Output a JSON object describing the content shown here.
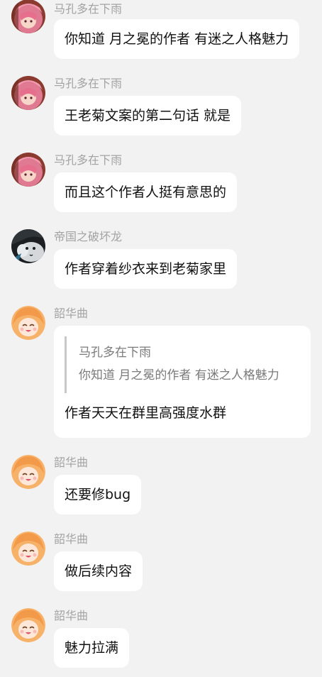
{
  "messages": [
    {
      "sender": "马孔多在下雨",
      "text": "你知道 月之冕的作者 有迷之人格魅力"
    },
    {
      "sender": "马孔多在下雨",
      "text": "王老菊文案的第二句话 就是"
    },
    {
      "sender": "马孔多在下雨",
      "text": "而且这个作者人挺有意思的"
    },
    {
      "sender": "帝国之破坏龙",
      "text": "作者穿着纱衣来到老菊家里"
    },
    {
      "sender": "韶华曲",
      "quote": {
        "author": "马孔多在下雨",
        "text": "你知道 月之冕的作者 有迷之人格魅力"
      },
      "text": "作者天天在群里高强度水群"
    },
    {
      "sender": "韶华曲",
      "text": "还要修bug"
    },
    {
      "sender": "韶华曲",
      "text": "做后续内容"
    },
    {
      "sender": "韶华曲",
      "text": "魅力拉满"
    }
  ],
  "avatars": {
    "makongduo": "pink-hair-anime-avatar",
    "dragon": "dark-dragon-avatar",
    "shaohuaqu": "orange-hair-anime-avatar"
  }
}
